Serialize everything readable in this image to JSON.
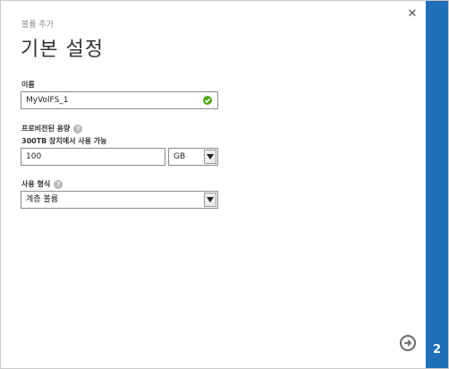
{
  "dialog": {
    "subtitle": "볼륨 추가",
    "title": "기본 설정",
    "close_icon": "close-icon",
    "step": "2"
  },
  "name_field": {
    "label": "이름",
    "value": "MyVolFS_1",
    "status_icon": "valid-check-icon"
  },
  "capacity_field": {
    "label": "프로비전된 용량",
    "help_icon": "help-icon",
    "note": "300TB 장치에서 사용 가능",
    "value": "100",
    "unit": "GB"
  },
  "usage_type_field": {
    "label": "사용 형식",
    "help_icon": "help-icon",
    "value": "계층 볼륨"
  },
  "navigation": {
    "next_icon": "arrow-right-circle-icon"
  },
  "colors": {
    "step_strip": "#1e6fb7",
    "valid": "#4fa81a"
  }
}
